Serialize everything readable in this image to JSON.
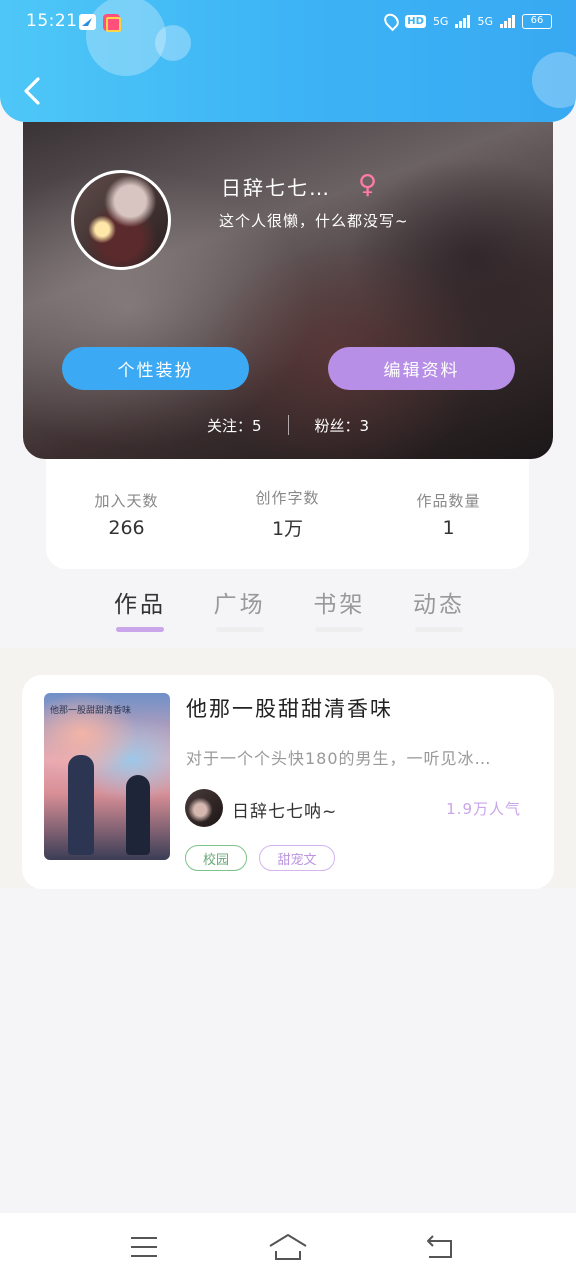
{
  "status_bar": {
    "time": "15:21",
    "hd_label": "HD",
    "network_1": "5G",
    "network_2": "5G",
    "battery": "66"
  },
  "profile": {
    "username": "日辞七七…",
    "gender_symbol": "♀",
    "bio": "这个人很懒，什么都没写~",
    "dress_button": "个性装扮",
    "edit_button": "编辑资料",
    "following_label": "关注：5",
    "followers_label": "粉丝：3"
  },
  "stats": [
    {
      "label": "加入天数",
      "value": "266"
    },
    {
      "label": "创作字数",
      "value": "1万"
    },
    {
      "label": "作品数量",
      "value": "1"
    }
  ],
  "tabs": [
    {
      "label": "作品",
      "active": true
    },
    {
      "label": "广场",
      "active": false
    },
    {
      "label": "书架",
      "active": false
    },
    {
      "label": "动态",
      "active": false
    }
  ],
  "work": {
    "title": "他那一股甜甜清香味",
    "description": "对于一个个头快180的男生，一听见冰…",
    "cover_caption": "他那一股甜甜清香味",
    "author": "日辞七七呐~",
    "popularity": "1.9万人气",
    "tags": [
      "校园",
      "甜宠文"
    ]
  },
  "colors": {
    "header_blue": "#3db4f5",
    "accent_purple": "#c9a5ea",
    "button_blue": "#3ba9f3",
    "button_purple": "#b88fe6"
  }
}
